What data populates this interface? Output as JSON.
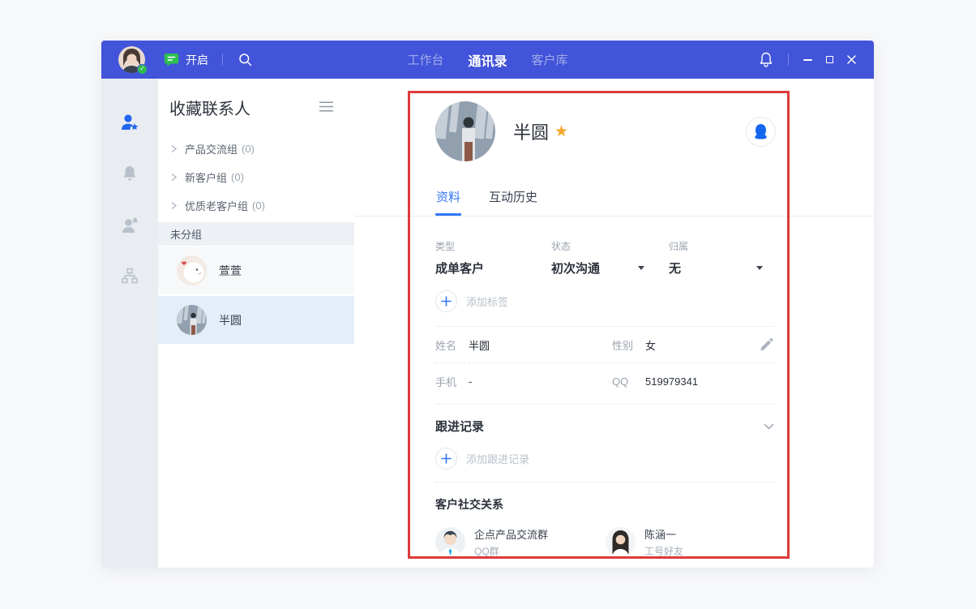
{
  "colors": {
    "titlebar_blue": "#4254d9",
    "accent_blue": "#3277f5",
    "icon_active_blue": "#2166ef",
    "qq_blue": "#1566f0",
    "star_orange": "#f6a32c",
    "green": "#2bbd4d",
    "annotation_red": "#de3b3b"
  },
  "icons": {
    "titlebar": [
      "user-avatar",
      "online-check-badge",
      "chat-bubble-icon",
      "search-icon",
      "bell-icon",
      "minimize-icon",
      "maximize-icon",
      "close-icon"
    ],
    "rail": [
      "favorite-contacts-icon",
      "notification-bell-icon",
      "customers-icon",
      "org-structure-icon"
    ],
    "detail": [
      "star-icon",
      "qq-penguin-icon",
      "dropdown-caret-icon",
      "plus-icon",
      "edit-pencil-icon",
      "chevron-down-icon"
    ]
  },
  "titlebar": {
    "status_label": "开启",
    "nav": [
      {
        "label": "工作台"
      },
      {
        "label": "通讯录"
      },
      {
        "label": "客户库"
      }
    ]
  },
  "contacts_panel": {
    "title": "收藏联系人",
    "groups": [
      {
        "label": "产品交流组",
        "count": "(0)"
      },
      {
        "label": "新客户组",
        "count": "(0)"
      },
      {
        "label": "优质老客户组",
        "count": "(0)"
      }
    ],
    "ungrouped_label": "未分组",
    "contacts": [
      {
        "name": "萱萱"
      },
      {
        "name": "半圆"
      }
    ]
  },
  "detail": {
    "name": "半圆",
    "tabs": [
      {
        "label": "资料"
      },
      {
        "label": "互动历史"
      }
    ],
    "fields": {
      "type_label": "类型",
      "type_value": "成单客户",
      "status_label": "状态",
      "status_value": "初次沟通",
      "owner_label": "归属",
      "owner_value": "无"
    },
    "add_tag_label": "添加标签",
    "info": {
      "name_label": "姓名",
      "name_value": "半圆",
      "gender_label": "性别",
      "gender_value": "女",
      "phone_label": "手机",
      "phone_value": "-",
      "qq_label": "QQ",
      "qq_value": "519979341"
    },
    "follow_up": {
      "title": "跟进记录",
      "add_label": "添加跟进记录"
    },
    "social": {
      "title": "客户社交关系",
      "relations": [
        {
          "name": "企点产品交流群",
          "type": "QQ群"
        },
        {
          "name": "陈涵一",
          "type": "工号好友"
        }
      ]
    }
  }
}
